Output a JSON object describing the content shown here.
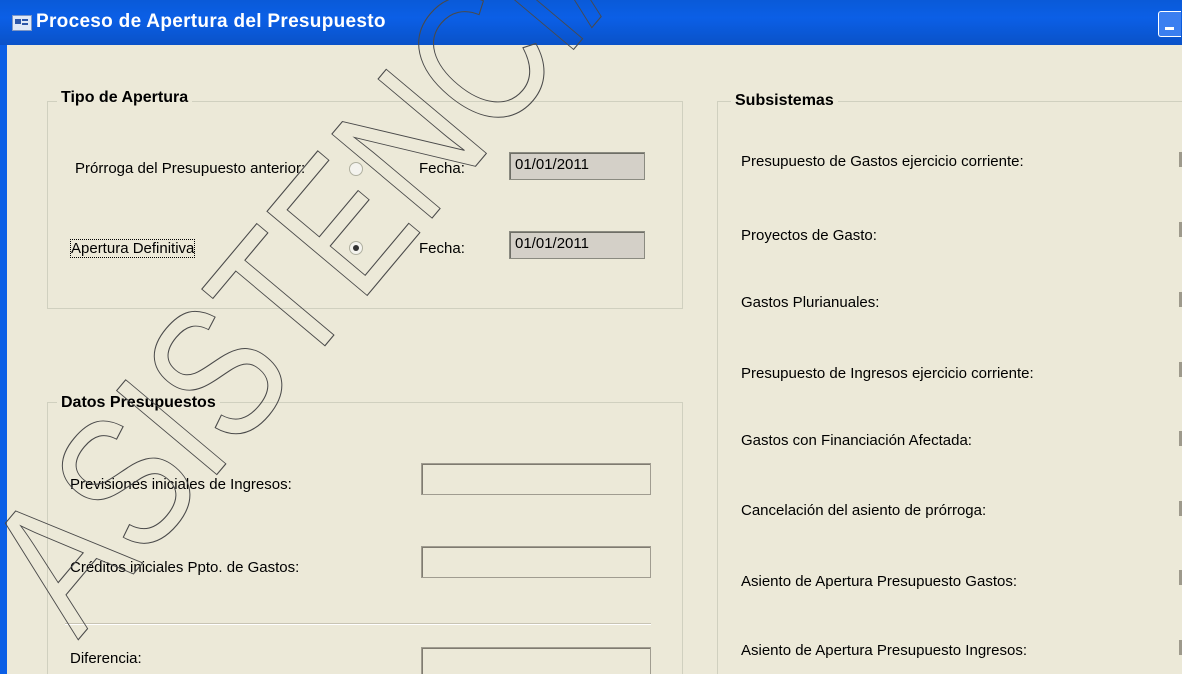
{
  "window": {
    "title": "Proceso de Apertura del Presupuesto"
  },
  "tipo_apertura": {
    "legend": "Tipo de Apertura",
    "prorroga": {
      "label": "Prórroga del Presupuesto anterior:",
      "selected": false,
      "fecha_label": "Fecha:",
      "fecha_value": "01/01/2011"
    },
    "definitiva": {
      "label": "Apertura Definitiva",
      "selected": true,
      "fecha_label": "Fecha:",
      "fecha_value": "01/01/2011"
    }
  },
  "datos_presupuestos": {
    "legend": "Datos Presupuestos",
    "previsiones_label": "Previsiones iniciales de Ingresos:",
    "previsiones_value": "",
    "creditos_label": "Créditos iniciales Ppto. de Gastos:",
    "creditos_value": "",
    "diferencia_label": "Diferencia:",
    "diferencia_value": ""
  },
  "subsistemas": {
    "legend": "Subsistemas",
    "items": [
      "Presupuesto de Gastos ejercicio corriente:",
      "Proyectos de Gasto:",
      "Gastos Plurianuales:",
      "Presupuesto de Ingresos ejercicio corriente:",
      "Gastos con Financiación Afectada:",
      "Cancelación del asiento de prórroga:",
      "Asiento de Apertura Presupuesto Gastos:",
      "Asiento de Apertura Presupuesto Ingresos:"
    ]
  },
  "watermark": {
    "text": "ASISTENCIA",
    "color": "#4a4a4a"
  },
  "colors": {
    "titlebar": "#0b5fe6",
    "client": "#ece9d8"
  }
}
